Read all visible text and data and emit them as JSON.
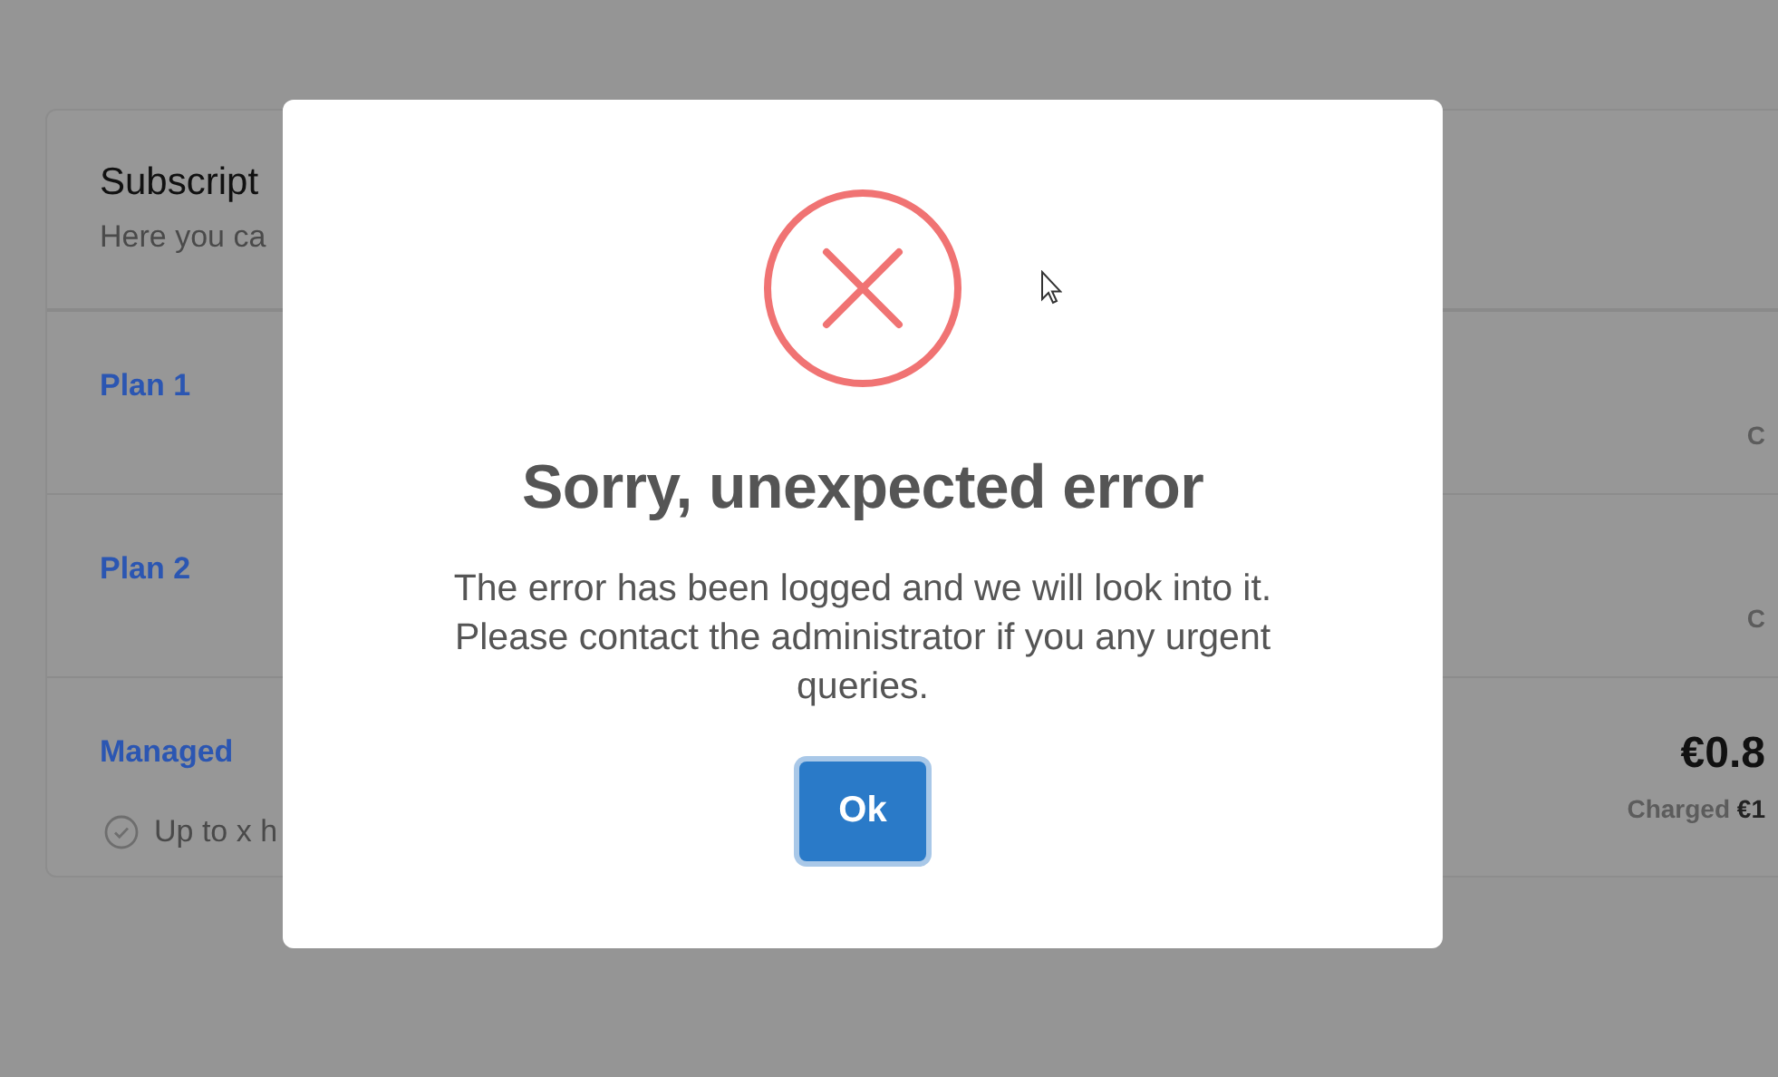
{
  "card": {
    "title": "Subscript",
    "subtitle": "Here you ca",
    "plans": [
      {
        "name": "Plan 1",
        "note": "C"
      },
      {
        "name": "Plan 2",
        "note": "C"
      },
      {
        "name": "Managed",
        "feature": "Up to x h",
        "price": "€0.8",
        "charged": "Charged **€1**"
      }
    ]
  },
  "dialog": {
    "title": "Sorry, unexpected error",
    "message": "The error has been logged and we will look into it. Please contact the administrator if you any urgent queries.",
    "button": "Ok"
  }
}
